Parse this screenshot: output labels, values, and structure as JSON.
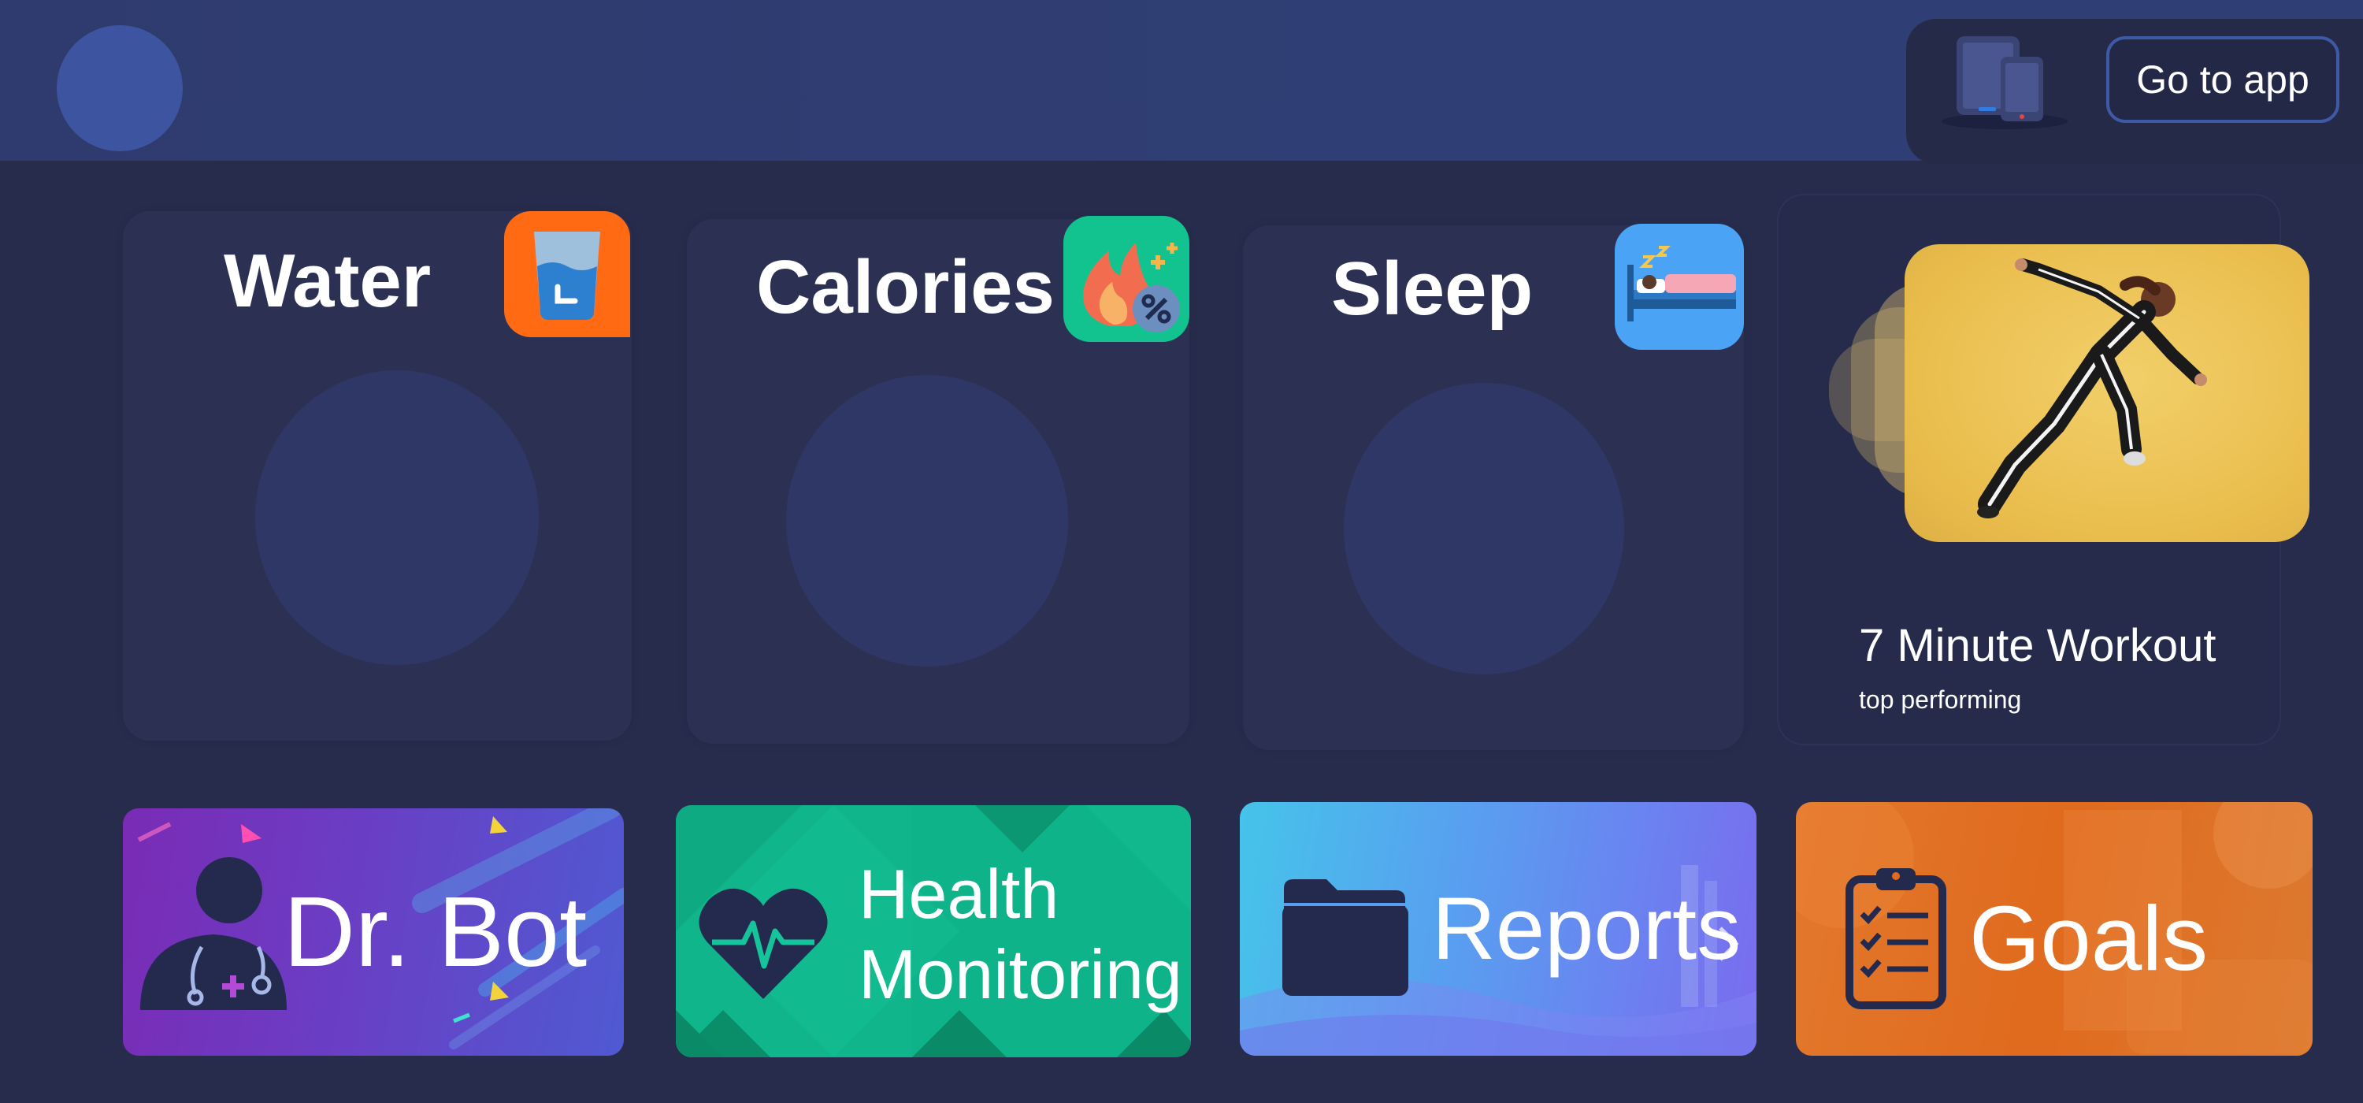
{
  "header": {
    "go_to_app_label": "Go to app"
  },
  "stats": [
    {
      "title": "Water",
      "icon": "water-glass-icon",
      "icon_bg": "#ff6a13"
    },
    {
      "title": "Calories",
      "icon": "calories-flame-icon",
      "icon_bg": "#12c38f"
    },
    {
      "title": "Sleep",
      "icon": "sleep-bed-icon",
      "icon_bg": "#4aa3f5"
    }
  ],
  "workout": {
    "title": "7 Minute Workout",
    "subtitle": "top performing"
  },
  "tiles": [
    {
      "label": "Dr. Bot",
      "icon": "doctor-icon"
    },
    {
      "label_line1": "Health",
      "label_line2": "Monitoring",
      "icon": "heartbeat-icon"
    },
    {
      "label": "Reports",
      "icon": "folder-icon"
    },
    {
      "label": "Goals",
      "icon": "clipboard-checklist-icon"
    }
  ],
  "colors": {
    "background": "#272c4c",
    "header": "#2f3e74",
    "card": "#2c3154",
    "accent_blue": "#3e5aa6"
  }
}
